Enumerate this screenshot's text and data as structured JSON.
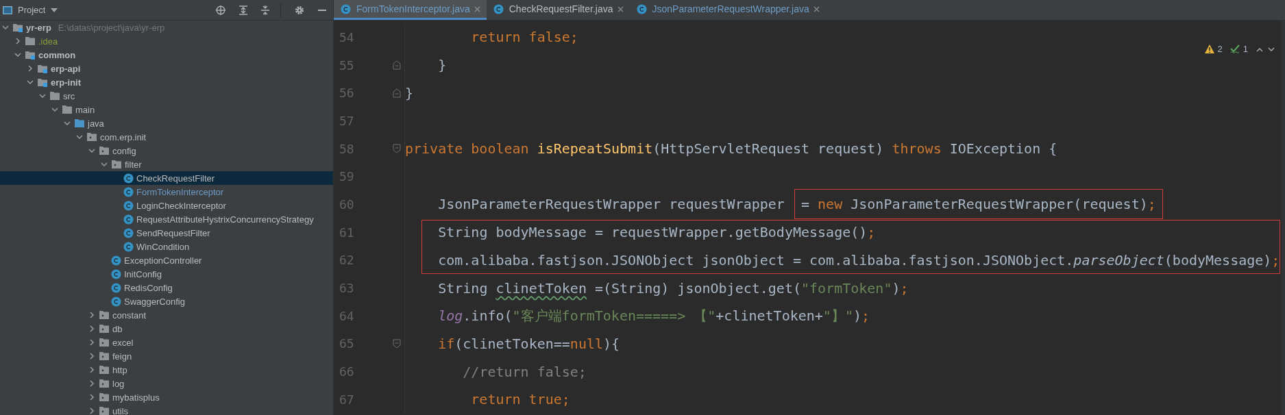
{
  "project_panel": {
    "title": "Project",
    "tree": [
      {
        "label": "yr-erp",
        "path": "E:\\datas\\project\\java\\yr-erp",
        "kind": "module",
        "modified": false,
        "ignored": false,
        "expanded": true,
        "selected": false,
        "children": [
          {
            "label": ".idea",
            "kind": "folder",
            "modified": false,
            "ignored": true,
            "expanded": false,
            "selected": false
          },
          {
            "label": "common",
            "kind": "module",
            "modified": false,
            "ignored": false,
            "expanded": true,
            "selected": false,
            "children": [
              {
                "label": "erp-api",
                "kind": "module",
                "modified": false,
                "ignored": false,
                "expanded": false,
                "selected": false
              },
              {
                "label": "erp-init",
                "kind": "module",
                "modified": false,
                "ignored": false,
                "expanded": true,
                "selected": false,
                "children": [
                  {
                    "label": "src",
                    "kind": "folder",
                    "modified": false,
                    "ignored": false,
                    "expanded": true,
                    "selected": false,
                    "children": [
                      {
                        "label": "main",
                        "kind": "folder",
                        "modified": false,
                        "ignored": false,
                        "expanded": true,
                        "selected": false,
                        "children": [
                          {
                            "label": "java",
                            "kind": "source-root",
                            "modified": false,
                            "ignored": false,
                            "expanded": true,
                            "selected": false,
                            "children": [
                              {
                                "label": "com.erp.init",
                                "kind": "package",
                                "modified": false,
                                "ignored": false,
                                "expanded": true,
                                "selected": false,
                                "children": [
                                  {
                                    "label": "config",
                                    "kind": "package",
                                    "modified": false,
                                    "ignored": false,
                                    "expanded": true,
                                    "selected": false,
                                    "children": [
                                      {
                                        "label": "filter",
                                        "kind": "package",
                                        "modified": false,
                                        "ignored": false,
                                        "expanded": true,
                                        "selected": false,
                                        "children": [
                                          {
                                            "label": "CheckRequestFilter",
                                            "kind": "class",
                                            "modified": false,
                                            "ignored": false,
                                            "selected": true
                                          },
                                          {
                                            "label": "FormTokenInterceptor",
                                            "kind": "class",
                                            "modified": true,
                                            "ignored": false,
                                            "selected": false
                                          },
                                          {
                                            "label": "LoginCheckInterceptor",
                                            "kind": "class",
                                            "modified": false,
                                            "ignored": false,
                                            "selected": false
                                          },
                                          {
                                            "label": "RequestAttributeHystrixConcurrencyStrategy",
                                            "kind": "class",
                                            "modified": false,
                                            "ignored": false,
                                            "selected": false
                                          },
                                          {
                                            "label": "SendRequestFilter",
                                            "kind": "class",
                                            "modified": false,
                                            "ignored": false,
                                            "selected": false
                                          },
                                          {
                                            "label": "WinCondition",
                                            "kind": "class",
                                            "modified": false,
                                            "ignored": false,
                                            "selected": false
                                          }
                                        ]
                                      },
                                      {
                                        "label": "ExceptionController",
                                        "kind": "class",
                                        "modified": false,
                                        "ignored": false,
                                        "selected": false
                                      },
                                      {
                                        "label": "InitConfig",
                                        "kind": "class",
                                        "modified": false,
                                        "ignored": false,
                                        "selected": false
                                      },
                                      {
                                        "label": "RedisConfig",
                                        "kind": "class",
                                        "modified": false,
                                        "ignored": false,
                                        "selected": false
                                      },
                                      {
                                        "label": "SwaggerConfig",
                                        "kind": "class",
                                        "modified": false,
                                        "ignored": false,
                                        "selected": false
                                      }
                                    ]
                                  },
                                  {
                                    "label": "constant",
                                    "kind": "package",
                                    "modified": false,
                                    "ignored": false,
                                    "expanded": false,
                                    "selected": false
                                  },
                                  {
                                    "label": "db",
                                    "kind": "package",
                                    "modified": false,
                                    "ignored": false,
                                    "expanded": false,
                                    "selected": false
                                  },
                                  {
                                    "label": "excel",
                                    "kind": "package",
                                    "modified": false,
                                    "ignored": false,
                                    "expanded": false,
                                    "selected": false
                                  },
                                  {
                                    "label": "feign",
                                    "kind": "package",
                                    "modified": false,
                                    "ignored": false,
                                    "expanded": false,
                                    "selected": false
                                  },
                                  {
                                    "label": "http",
                                    "kind": "package",
                                    "modified": false,
                                    "ignored": false,
                                    "expanded": false,
                                    "selected": false
                                  },
                                  {
                                    "label": "log",
                                    "kind": "package",
                                    "modified": false,
                                    "ignored": false,
                                    "expanded": false,
                                    "selected": false
                                  },
                                  {
                                    "label": "mybatisplus",
                                    "kind": "package",
                                    "modified": false,
                                    "ignored": false,
                                    "expanded": false,
                                    "selected": false
                                  },
                                  {
                                    "label": "utils",
                                    "kind": "package",
                                    "modified": false,
                                    "ignored": false,
                                    "expanded": false,
                                    "selected": false
                                  }
                                ]
                              }
                            ]
                          }
                        ]
                      }
                    ]
                  }
                ]
              }
            ]
          }
        ]
      }
    ]
  },
  "editor": {
    "tabs": [
      {
        "label": "FormTokenInterceptor.java",
        "modified": true,
        "selected": true
      },
      {
        "label": "CheckRequestFilter.java",
        "modified": false,
        "selected": false
      },
      {
        "label": "JsonParameterRequestWrapper.java",
        "modified": true,
        "selected": false
      }
    ],
    "inspections": {
      "warnings": "2",
      "weak_warnings": "1"
    },
    "lines": [
      {
        "number": "54",
        "kind": "plain",
        "boxed": false,
        "tokens": [
          {
            "text": "        return false;",
            "kind": "keyword"
          }
        ]
      },
      {
        "number": "55",
        "kind": "fold-end",
        "boxed": false,
        "tokens": [
          {
            "text": "    }",
            "kind": "plain"
          }
        ]
      },
      {
        "number": "56",
        "kind": "fold-end",
        "boxed": false,
        "tokens": [
          {
            "text": "}",
            "kind": "plain"
          }
        ]
      },
      {
        "number": "57",
        "kind": "plain",
        "boxed": false
      },
      {
        "number": "58",
        "kind": "fold-start",
        "boxed": false,
        "tokens": [
          {
            "text": "private boolean ",
            "kind": "keyword"
          },
          {
            "text": "isRepeatSubmit",
            "kind": "method"
          },
          {
            "text": "(HttpServletRequest request) ",
            "kind": "plain"
          },
          {
            "text": "throws ",
            "kind": "keyword"
          },
          {
            "text": "IOException {",
            "kind": "plain"
          }
        ]
      },
      {
        "number": "59",
        "kind": "plain",
        "boxed": false
      },
      {
        "number": "60",
        "kind": "plain",
        "boxed": false,
        "tokens": [
          {
            "text": "    JsonParameterRequestWrapper requestWrapper ",
            "kind": "plain"
          }
        ],
        "boxed_tokens": [
          {
            "text": "= ",
            "kind": "plain"
          },
          {
            "text": "new",
            "kind": "keyword"
          },
          {
            "text": " JsonParameterRequestWrapper(request)",
            "kind": "plain"
          },
          {
            "text": ";",
            "kind": "keyword"
          }
        ]
      },
      {
        "number": "61",
        "kind": "plain",
        "boxed": true,
        "tokens": [
          {
            "text": "    String bodyMessage = requestWrapper.getBodyMessage()",
            "kind": "plain"
          },
          {
            "text": ";",
            "kind": "keyword"
          }
        ]
      },
      {
        "number": "62",
        "kind": "plain",
        "boxed": true,
        "tokens": [
          {
            "text": "    com.alibaba.fastjson.JSONObject jsonObject = com.alibaba.fastjson.JSONObject.",
            "kind": "plain"
          },
          {
            "text": "parseObject",
            "kind": "static-call"
          },
          {
            "text": "(bodyMessage)",
            "kind": "plain"
          },
          {
            "text": ";",
            "kind": "keyword"
          }
        ]
      },
      {
        "number": "63",
        "kind": "plain",
        "boxed": false,
        "tokens": [
          {
            "text": "    String ",
            "kind": "plain"
          },
          {
            "text": "clinetToken",
            "kind": "typo"
          },
          {
            "text": " =(String) jsonObject.get(",
            "kind": "plain"
          },
          {
            "text": "\"formToken\"",
            "kind": "string"
          },
          {
            "text": ")",
            "kind": "plain"
          },
          {
            "text": ";",
            "kind": "keyword"
          }
        ]
      },
      {
        "number": "64",
        "kind": "plain",
        "boxed": false,
        "tokens": [
          {
            "text": "    log",
            "kind": "field"
          },
          {
            "text": ".info(",
            "kind": "plain"
          },
          {
            "text": "\"客户端formToken=====> 【\"",
            "kind": "string"
          },
          {
            "text": "+clinetToken+",
            "kind": "plain"
          },
          {
            "text": "\"】\"",
            "kind": "string"
          },
          {
            "text": ")",
            "kind": "plain"
          },
          {
            "text": ";",
            "kind": "keyword"
          }
        ]
      },
      {
        "number": "65",
        "kind": "fold-start",
        "boxed": false,
        "tokens": [
          {
            "text": "    if",
            "kind": "keyword"
          },
          {
            "text": "(clinetToken==",
            "kind": "plain"
          },
          {
            "text": "null",
            "kind": "keyword"
          },
          {
            "text": "){",
            "kind": "plain"
          }
        ]
      },
      {
        "number": "66",
        "kind": "plain",
        "boxed": false,
        "tokens": [
          {
            "text": "       //return false;",
            "kind": "comment"
          }
        ]
      },
      {
        "number": "67",
        "kind": "plain",
        "boxed": false,
        "tokens": [
          {
            "text": "        return true;",
            "kind": "keyword"
          }
        ]
      }
    ]
  }
}
